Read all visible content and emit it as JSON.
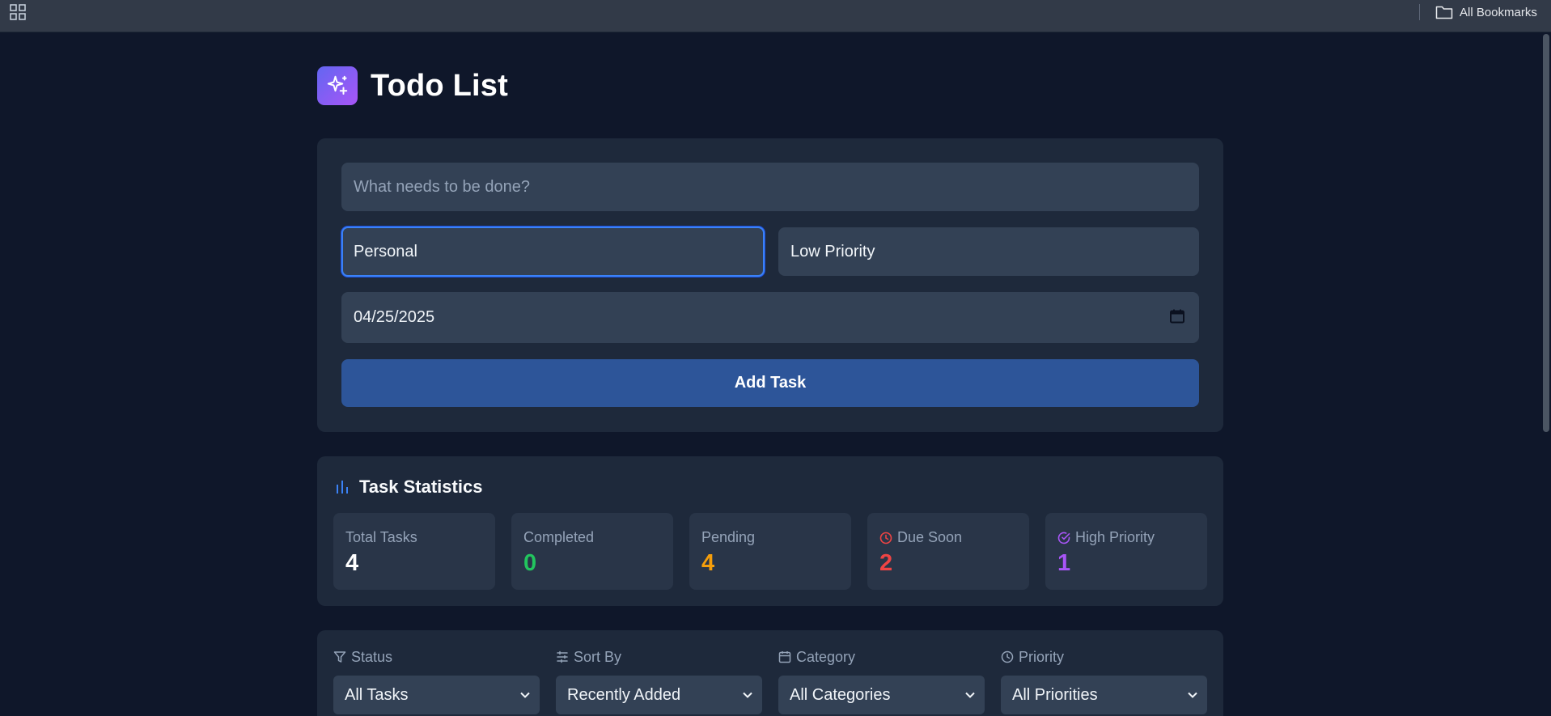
{
  "browser": {
    "bookmarks_folder_label": "All Bookmarks",
    "apps_icon": "apps-grid-icon",
    "folder_icon": "folder-icon"
  },
  "header": {
    "title": "Todo List",
    "logo_icon": "sparkles-icon"
  },
  "form": {
    "task_placeholder": "What needs to be done?",
    "task_value": "",
    "category_value": "Personal",
    "priority_value": "Low Priority",
    "due_date_value": "04/25/2025",
    "add_button_label": "Add Task"
  },
  "stats": {
    "title": "Task Statistics",
    "items": [
      {
        "label": "Total Tasks",
        "value": "4",
        "color": "#ffffff",
        "icon": ""
      },
      {
        "label": "Completed",
        "value": "0",
        "color": "#22c55e",
        "icon": ""
      },
      {
        "label": "Pending",
        "value": "4",
        "color": "#f59e0b",
        "icon": ""
      },
      {
        "label": "Due Soon",
        "value": "2",
        "color": "#ef4444",
        "icon": "clock-icon"
      },
      {
        "label": "High Priority",
        "value": "1",
        "color": "#a855f7",
        "icon": "check-circle-icon"
      }
    ]
  },
  "filters": [
    {
      "label": "Status",
      "selected": "All Tasks",
      "icon": "filter-icon"
    },
    {
      "label": "Sort By",
      "selected": "Recently Added",
      "icon": "sliders-icon"
    },
    {
      "label": "Category",
      "selected": "All Categories",
      "icon": "calendar-icon"
    },
    {
      "label": "Priority",
      "selected": "All Priorities",
      "icon": "clock-icon"
    }
  ],
  "colors": {
    "background": "#0f172a",
    "card": "#1e293b",
    "input": "#334155",
    "accent_button": "#2d5599",
    "focus_ring": "#3b82f6"
  }
}
